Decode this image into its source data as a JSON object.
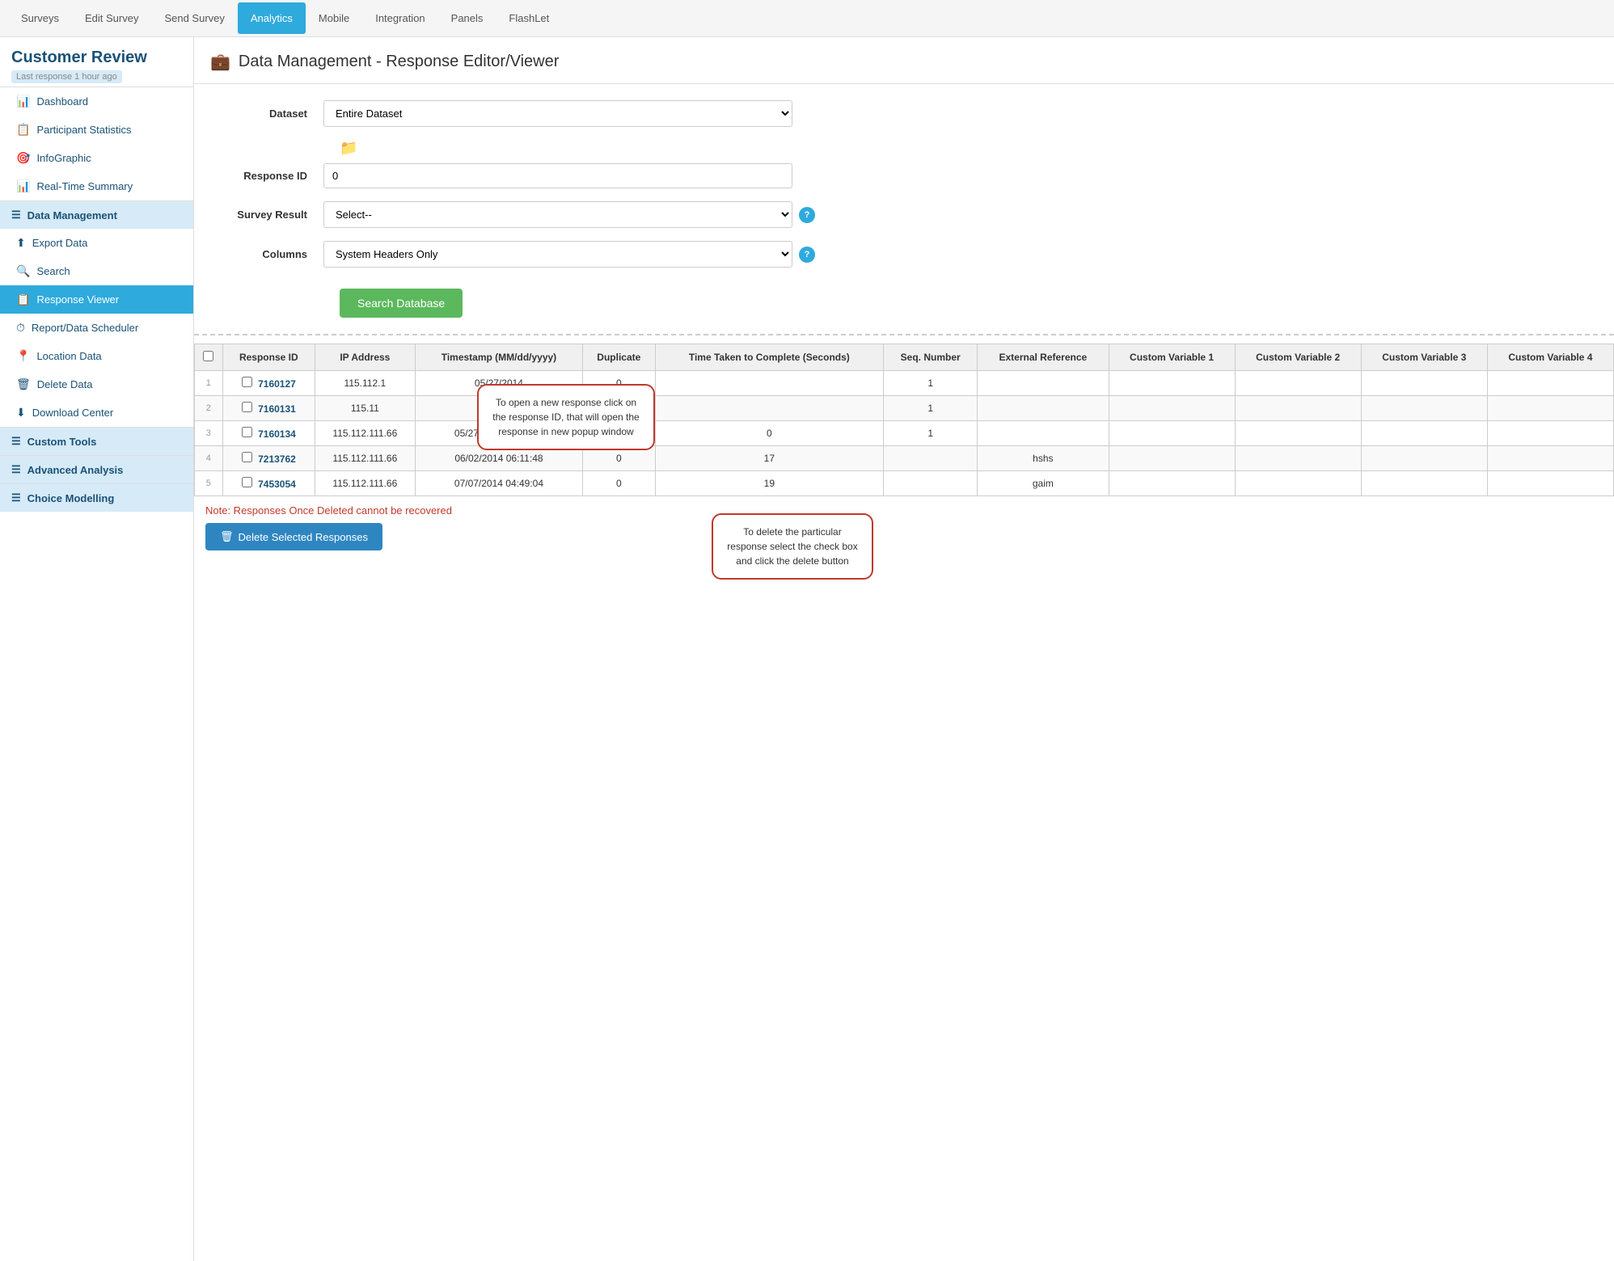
{
  "app": {
    "title": "Customer Review",
    "subtitle": "Last response 1 hour ago"
  },
  "topnav": {
    "items": [
      {
        "label": "Surveys",
        "active": false
      },
      {
        "label": "Edit Survey",
        "active": false
      },
      {
        "label": "Send Survey",
        "active": false
      },
      {
        "label": "Analytics",
        "active": true
      },
      {
        "label": "Mobile",
        "active": false
      },
      {
        "label": "Integration",
        "active": false
      },
      {
        "label": "Panels",
        "active": false
      },
      {
        "label": "FlashLet",
        "active": false
      }
    ]
  },
  "sidebar": {
    "items": [
      {
        "label": "Dashboard",
        "icon": "📊",
        "active": false,
        "type": "item"
      },
      {
        "label": "Participant Statistics",
        "icon": "📋",
        "active": false,
        "type": "item"
      },
      {
        "label": "InfoGraphic",
        "icon": "🎯",
        "active": false,
        "type": "item"
      },
      {
        "label": "Real-Time Summary",
        "icon": "📊",
        "active": false,
        "type": "item"
      },
      {
        "label": "Data Management",
        "icon": "☰",
        "active": false,
        "type": "section"
      },
      {
        "label": "Export Data",
        "icon": "⬆",
        "active": false,
        "type": "item"
      },
      {
        "label": "Search",
        "icon": "🔍",
        "active": false,
        "type": "item"
      },
      {
        "label": "Response Viewer",
        "icon": "📋",
        "active": true,
        "type": "item"
      },
      {
        "label": "Report/Data Scheduler",
        "icon": "⏱",
        "active": false,
        "type": "item"
      },
      {
        "label": "Location Data",
        "icon": "📍",
        "active": false,
        "type": "item"
      },
      {
        "label": "Delete Data",
        "icon": "🗑",
        "active": false,
        "type": "item"
      },
      {
        "label": "Download Center",
        "icon": "⬇",
        "active": false,
        "type": "item"
      },
      {
        "label": "Custom Tools",
        "icon": "☰",
        "active": false,
        "type": "section"
      },
      {
        "label": "Advanced Analysis",
        "icon": "☰",
        "active": false,
        "type": "section"
      },
      {
        "label": "Choice Modelling",
        "icon": "☰",
        "active": false,
        "type": "section"
      }
    ]
  },
  "page": {
    "title": "Data Management - Response Editor/Viewer",
    "icon": "💼"
  },
  "form": {
    "dataset_label": "Dataset",
    "dataset_value": "Entire Dataset",
    "dataset_options": [
      "Entire Dataset"
    ],
    "response_id_label": "Response ID",
    "response_id_value": "0",
    "survey_result_label": "Survey Result",
    "survey_result_value": "Select--",
    "survey_result_options": [
      "Select--"
    ],
    "columns_label": "Columns",
    "columns_value": "System Headers Only",
    "columns_options": [
      "System Headers Only"
    ],
    "search_button": "Search Database"
  },
  "table": {
    "headers": [
      "",
      "Response ID",
      "IP Address",
      "Timestamp (MM/dd/yyyy)",
      "Duplicate",
      "Time Taken to Complete (Seconds)",
      "Seq. Number",
      "External Reference",
      "Custom Variable 1",
      "Custom Variable 2",
      "Custom Variable 3",
      "Custom Variable 4"
    ],
    "rows": [
      {
        "num": "1",
        "response_id": "7160127",
        "ip": "115.112.1",
        "timestamp": "05/27/2014",
        "duplicate": "0",
        "time_taken": "",
        "seq_num": "1",
        "ext_ref": "",
        "cv1": "",
        "cv2": "",
        "cv3": "",
        "cv4": ""
      },
      {
        "num": "2",
        "response_id": "7160131",
        "ip": "115.11",
        "timestamp": "",
        "duplicate": "0",
        "time_taken": "",
        "seq_num": "1",
        "ext_ref": "",
        "cv1": "",
        "cv2": "",
        "cv3": "",
        "cv4": ""
      },
      {
        "num": "3",
        "response_id": "7160134",
        "ip": "115.112.111.66",
        "timestamp": "05/27/2014 02:12:05",
        "duplicate": "0",
        "time_taken": "0",
        "seq_num": "1",
        "ext_ref": "",
        "cv1": "",
        "cv2": "",
        "cv3": "",
        "cv4": ""
      },
      {
        "num": "4",
        "response_id": "7213762",
        "ip": "115.112.111.66",
        "timestamp": "06/02/2014 06:11:48",
        "duplicate": "0",
        "time_taken": "17",
        "seq_num": "",
        "ext_ref": "hshs",
        "cv1": "",
        "cv2": "",
        "cv3": "",
        "cv4": ""
      },
      {
        "num": "5",
        "response_id": "7453054",
        "ip": "115.112.111.66",
        "timestamp": "07/07/2014 04:49:04",
        "duplicate": "0",
        "time_taken": "19",
        "seq_num": "",
        "ext_ref": "gaim",
        "cv1": "",
        "cv2": "",
        "cv3": "",
        "cv4": ""
      }
    ]
  },
  "tooltips": {
    "tooltip1": "To open a new response click on the response ID, that will open the response in new popup window",
    "tooltip2": "To delete the particular response select the check box and click the delete button"
  },
  "bottom": {
    "note": "Note: Responses Once Deleted cannot be recovered",
    "delete_button": "Delete Selected Responses"
  }
}
